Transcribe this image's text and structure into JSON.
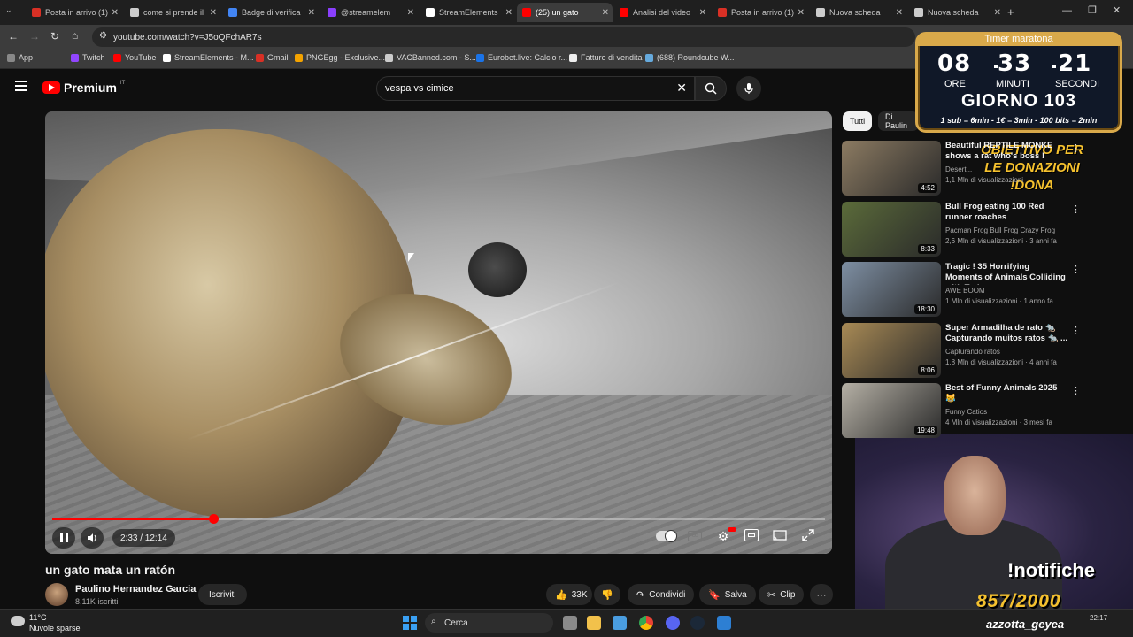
{
  "browser": {
    "tabs": [
      {
        "label": "Posta in arrivo (1)",
        "color": "#d93025"
      },
      {
        "label": "come si prende il",
        "color": "#cccccc"
      },
      {
        "label": "Badge di verifica",
        "color": "#4285f4"
      },
      {
        "label": "@streamelem",
        "color": "#8a3ffc"
      },
      {
        "label": "StreamElements",
        "color": "#ffffff"
      },
      {
        "label": "(25) un gato",
        "color": "#ff0000"
      },
      {
        "label": "Analisi del video",
        "color": "#ff0000"
      },
      {
        "label": "Posta in arrivo (1)",
        "color": "#d93025"
      },
      {
        "label": "Nuova scheda",
        "color": "#cccccc"
      },
      {
        "label": "Nuova scheda",
        "color": "#cccccc"
      }
    ],
    "active_tab_index": 5,
    "url": "youtube.com/watch?v=J5oQFchAR7s",
    "bookmarks": [
      {
        "label": "App",
        "color": "#888888"
      },
      {
        "label": "Twitch",
        "color": "#9146ff"
      },
      {
        "label": "YouTube",
        "color": "#ff0000"
      },
      {
        "label": "StreamElements - M...",
        "color": "#ffffff"
      },
      {
        "label": "Gmail",
        "color": "#d93025"
      },
      {
        "label": "PNGEgg - Exclusive...",
        "color": "#f4a300"
      },
      {
        "label": "VACBanned.com - S...",
        "color": "#cccccc"
      },
      {
        "label": "Eurobet.live: Calcio r...",
        "color": "#1a73e8"
      },
      {
        "label": "Fatture di vendita",
        "color": "#eeeeee"
      },
      {
        "label": "(688) Roundcube W...",
        "color": "#66aadd"
      }
    ]
  },
  "youtube": {
    "logo_text": "Premium",
    "logo_sup": "IT",
    "search_value": "vespa vs cimice",
    "video": {
      "title": "un gato mata un ratón",
      "time_text": "2:33 / 12:14",
      "progress": 0.209
    },
    "channel": {
      "name": "Paulino Hernandez Garcia",
      "subscribers": "8,11K iscritti",
      "subscribe_label": "Iscriviti"
    },
    "actions": {
      "likes": "33K",
      "share": "Condividi",
      "save": "Salva",
      "clip": "Clip"
    },
    "filters": [
      "Tutti",
      "Di Paulin"
    ],
    "recommendations": [
      {
        "title": "Beautiful REPTILE MONKE shows a rat who's boss !",
        "channel": "Desert...",
        "views": "1,1 Mln di visualizzazioni",
        "duration": "4:52",
        "thumb": "#8c7b62"
      },
      {
        "title": "Bull Frog eating 100  Red runner roaches",
        "channel": "Pacman Frog Bull Frog Crazy Frog",
        "views": "2,6 Mln di visualizzazioni · 3 anni fa",
        "duration": "8:33",
        "thumb": "#5b6b3a"
      },
      {
        "title": "Tragic ! 35 Horrifying Moments of Animals Colliding with Train...",
        "channel": "AWE BOOM",
        "views": "1 Mln di visualizzazioni · 1 anno fa",
        "duration": "18:30",
        "thumb": "#7e8fa3"
      },
      {
        "title": "Super Armadilha de rato 🐀 Capturando muitos ratos 🐀 ...",
        "channel": "Capturando ratos",
        "views": "1,8 Mln di visualizzazioni · 4 anni fa",
        "duration": "8:06",
        "thumb": "#a88a55"
      },
      {
        "title": "Best of Funny Animals 2025 😹",
        "channel": "Funny Catios",
        "views": "4 Mln di visualizzazioni · 3 mesi fa",
        "duration": "19:48",
        "thumb": "#b5b0a5"
      }
    ]
  },
  "overlay": {
    "timer_title": "Timer maratona",
    "hours": "08",
    "minutes": "33",
    "seconds": "21",
    "hours_label": "ORE",
    "minutes_label": "MINUTI",
    "seconds_label": "SECONDI",
    "day": "GIORNO 103",
    "rates": "1 sub = 6min - 1€ = 3min - 100 bits = 2min",
    "donate_lines": [
      "OBIETTIVO PER",
      "LE DONAZIONI",
      "!DONA"
    ],
    "notifiche": "!notifiche",
    "goal": "857/2000",
    "ticker": "azzotta_geyea"
  },
  "taskbar": {
    "temperature": "11°C",
    "weather": "Nuvole sparse",
    "search_placeholder": "Cerca",
    "time": "22:17"
  }
}
